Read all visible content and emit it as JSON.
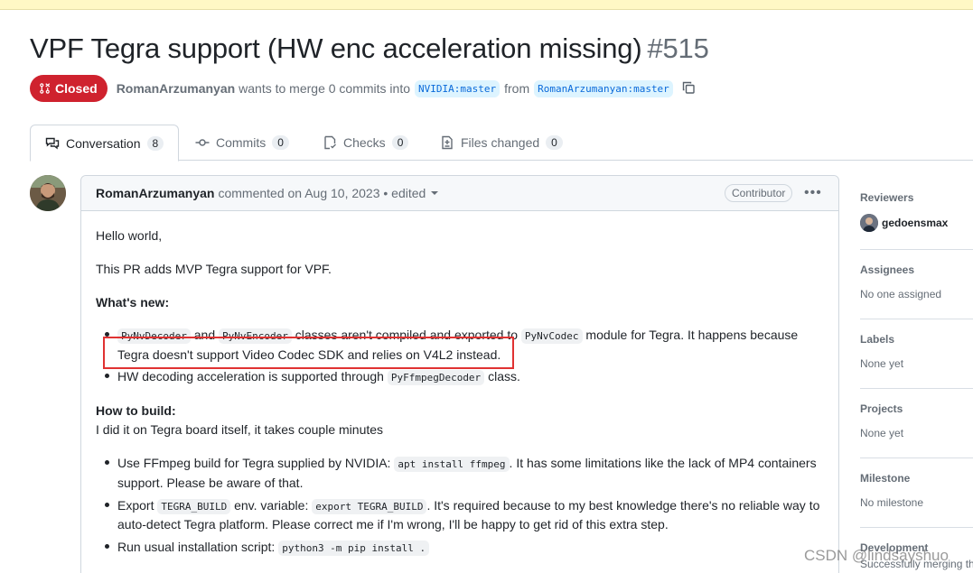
{
  "pr": {
    "title": "VPF Tegra support (HW enc acceleration missing)",
    "number": "#515",
    "state": "Closed",
    "author": "RomanArzumanyan",
    "merge_text": "wants to merge 0 commits into",
    "base_branch": "NVIDIA:master",
    "from_text": "from",
    "head_branch": "RomanArzumanyan:master"
  },
  "tabs": [
    {
      "label": "Conversation",
      "count": "8",
      "icon": "comment-discussion-icon"
    },
    {
      "label": "Commits",
      "count": "0",
      "icon": "git-commit-icon"
    },
    {
      "label": "Checks",
      "count": "0",
      "icon": "checklist-icon"
    },
    {
      "label": "Files changed",
      "count": "0",
      "icon": "file-diff-icon"
    }
  ],
  "comment": {
    "author": "RomanArzumanyan",
    "meta": "commented on Aug 10, 2023 • edited",
    "badge": "Contributor",
    "p1": "Hello world,",
    "p2": "This PR adds MVP Tegra support for VPF.",
    "whats_new": "What's new:",
    "item1_code1": "PyNvDecoder",
    "item1_and": "and",
    "item1_code2": "PyNvEncoder",
    "item1_text1": "classes aren't compiled and exported to",
    "item1_code3": "PyNvCodec",
    "item1_text2": "module for Tegra. It happens because",
    "item1_line2": "Tegra doesn't support Video Codec SDK and relies on V4L2 instead.",
    "item2_text": "HW decoding acceleration is supported through",
    "item2_code": "PyFfmpegDecoder",
    "item2_end": "class.",
    "how_to_build": "How to build:",
    "how_to_desc": "I did it on Tegra board itself, it takes couple minutes",
    "b1_text": "Use FFmpeg build for Tegra supplied by NVIDIA:",
    "b1_code": "apt install ffmpeg",
    "b1_text2": ". It has some limitations like the lack of MP4 containers",
    "b1_line2": "support. Please be aware of that.",
    "b2_text": "Export",
    "b2_code1": "TEGRA_BUILD",
    "b2_text2": "env. variable:",
    "b2_code2": "export TEGRA_BUILD",
    "b2_text3": ". It's required because to my best knowledge there's no reliable way to",
    "b2_line2": "auto-detect Tegra platform. Please correct me if I'm wrong, I'll be happy to get rid of this extra step.",
    "b3_text": "Run usual installation script:",
    "b3_code": "python3 -m pip install ."
  },
  "sidebar": {
    "reviewers_title": "Reviewers",
    "reviewer": "gedoensmax",
    "assignees_title": "Assignees",
    "assignees_value": "No one assigned",
    "labels_title": "Labels",
    "labels_value": "None yet",
    "projects_title": "Projects",
    "projects_value": "None yet",
    "milestone_title": "Milestone",
    "milestone_value": "No milestone",
    "development_title": "Development",
    "development_value": "Successfully merging th"
  },
  "watermark": "CSDN @lindsayshuo",
  "colors": {
    "closed": "#cf222e",
    "branch_bg": "#ddf4ff",
    "branch_text": "#0969da",
    "highlight": "#e03232"
  }
}
